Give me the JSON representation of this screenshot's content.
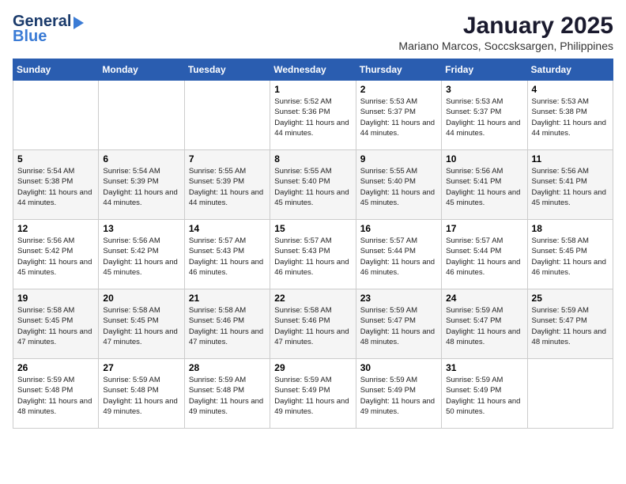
{
  "logo": {
    "line1": "General",
    "line2": "Blue"
  },
  "title": "January 2025",
  "subtitle": "Mariano Marcos, Soccsksargen, Philippines",
  "days_header": [
    "Sunday",
    "Monday",
    "Tuesday",
    "Wednesday",
    "Thursday",
    "Friday",
    "Saturday"
  ],
  "weeks": [
    [
      {
        "day": "",
        "sunrise": "",
        "sunset": "",
        "daylight": ""
      },
      {
        "day": "",
        "sunrise": "",
        "sunset": "",
        "daylight": ""
      },
      {
        "day": "",
        "sunrise": "",
        "sunset": "",
        "daylight": ""
      },
      {
        "day": "1",
        "sunrise": "Sunrise: 5:52 AM",
        "sunset": "Sunset: 5:36 PM",
        "daylight": "Daylight: 11 hours and 44 minutes."
      },
      {
        "day": "2",
        "sunrise": "Sunrise: 5:53 AM",
        "sunset": "Sunset: 5:37 PM",
        "daylight": "Daylight: 11 hours and 44 minutes."
      },
      {
        "day": "3",
        "sunrise": "Sunrise: 5:53 AM",
        "sunset": "Sunset: 5:37 PM",
        "daylight": "Daylight: 11 hours and 44 minutes."
      },
      {
        "day": "4",
        "sunrise": "Sunrise: 5:53 AM",
        "sunset": "Sunset: 5:38 PM",
        "daylight": "Daylight: 11 hours and 44 minutes."
      }
    ],
    [
      {
        "day": "5",
        "sunrise": "Sunrise: 5:54 AM",
        "sunset": "Sunset: 5:38 PM",
        "daylight": "Daylight: 11 hours and 44 minutes."
      },
      {
        "day": "6",
        "sunrise": "Sunrise: 5:54 AM",
        "sunset": "Sunset: 5:39 PM",
        "daylight": "Daylight: 11 hours and 44 minutes."
      },
      {
        "day": "7",
        "sunrise": "Sunrise: 5:55 AM",
        "sunset": "Sunset: 5:39 PM",
        "daylight": "Daylight: 11 hours and 44 minutes."
      },
      {
        "day": "8",
        "sunrise": "Sunrise: 5:55 AM",
        "sunset": "Sunset: 5:40 PM",
        "daylight": "Daylight: 11 hours and 45 minutes."
      },
      {
        "day": "9",
        "sunrise": "Sunrise: 5:55 AM",
        "sunset": "Sunset: 5:40 PM",
        "daylight": "Daylight: 11 hours and 45 minutes."
      },
      {
        "day": "10",
        "sunrise": "Sunrise: 5:56 AM",
        "sunset": "Sunset: 5:41 PM",
        "daylight": "Daylight: 11 hours and 45 minutes."
      },
      {
        "day": "11",
        "sunrise": "Sunrise: 5:56 AM",
        "sunset": "Sunset: 5:41 PM",
        "daylight": "Daylight: 11 hours and 45 minutes."
      }
    ],
    [
      {
        "day": "12",
        "sunrise": "Sunrise: 5:56 AM",
        "sunset": "Sunset: 5:42 PM",
        "daylight": "Daylight: 11 hours and 45 minutes."
      },
      {
        "day": "13",
        "sunrise": "Sunrise: 5:56 AM",
        "sunset": "Sunset: 5:42 PM",
        "daylight": "Daylight: 11 hours and 45 minutes."
      },
      {
        "day": "14",
        "sunrise": "Sunrise: 5:57 AM",
        "sunset": "Sunset: 5:43 PM",
        "daylight": "Daylight: 11 hours and 46 minutes."
      },
      {
        "day": "15",
        "sunrise": "Sunrise: 5:57 AM",
        "sunset": "Sunset: 5:43 PM",
        "daylight": "Daylight: 11 hours and 46 minutes."
      },
      {
        "day": "16",
        "sunrise": "Sunrise: 5:57 AM",
        "sunset": "Sunset: 5:44 PM",
        "daylight": "Daylight: 11 hours and 46 minutes."
      },
      {
        "day": "17",
        "sunrise": "Sunrise: 5:57 AM",
        "sunset": "Sunset: 5:44 PM",
        "daylight": "Daylight: 11 hours and 46 minutes."
      },
      {
        "day": "18",
        "sunrise": "Sunrise: 5:58 AM",
        "sunset": "Sunset: 5:45 PM",
        "daylight": "Daylight: 11 hours and 46 minutes."
      }
    ],
    [
      {
        "day": "19",
        "sunrise": "Sunrise: 5:58 AM",
        "sunset": "Sunset: 5:45 PM",
        "daylight": "Daylight: 11 hours and 47 minutes."
      },
      {
        "day": "20",
        "sunrise": "Sunrise: 5:58 AM",
        "sunset": "Sunset: 5:45 PM",
        "daylight": "Daylight: 11 hours and 47 minutes."
      },
      {
        "day": "21",
        "sunrise": "Sunrise: 5:58 AM",
        "sunset": "Sunset: 5:46 PM",
        "daylight": "Daylight: 11 hours and 47 minutes."
      },
      {
        "day": "22",
        "sunrise": "Sunrise: 5:58 AM",
        "sunset": "Sunset: 5:46 PM",
        "daylight": "Daylight: 11 hours and 47 minutes."
      },
      {
        "day": "23",
        "sunrise": "Sunrise: 5:59 AM",
        "sunset": "Sunset: 5:47 PM",
        "daylight": "Daylight: 11 hours and 48 minutes."
      },
      {
        "day": "24",
        "sunrise": "Sunrise: 5:59 AM",
        "sunset": "Sunset: 5:47 PM",
        "daylight": "Daylight: 11 hours and 48 minutes."
      },
      {
        "day": "25",
        "sunrise": "Sunrise: 5:59 AM",
        "sunset": "Sunset: 5:47 PM",
        "daylight": "Daylight: 11 hours and 48 minutes."
      }
    ],
    [
      {
        "day": "26",
        "sunrise": "Sunrise: 5:59 AM",
        "sunset": "Sunset: 5:48 PM",
        "daylight": "Daylight: 11 hours and 48 minutes."
      },
      {
        "day": "27",
        "sunrise": "Sunrise: 5:59 AM",
        "sunset": "Sunset: 5:48 PM",
        "daylight": "Daylight: 11 hours and 49 minutes."
      },
      {
        "day": "28",
        "sunrise": "Sunrise: 5:59 AM",
        "sunset": "Sunset: 5:48 PM",
        "daylight": "Daylight: 11 hours and 49 minutes."
      },
      {
        "day": "29",
        "sunrise": "Sunrise: 5:59 AM",
        "sunset": "Sunset: 5:49 PM",
        "daylight": "Daylight: 11 hours and 49 minutes."
      },
      {
        "day": "30",
        "sunrise": "Sunrise: 5:59 AM",
        "sunset": "Sunset: 5:49 PM",
        "daylight": "Daylight: 11 hours and 49 minutes."
      },
      {
        "day": "31",
        "sunrise": "Sunrise: 5:59 AM",
        "sunset": "Sunset: 5:49 PM",
        "daylight": "Daylight: 11 hours and 50 minutes."
      },
      {
        "day": "",
        "sunrise": "",
        "sunset": "",
        "daylight": ""
      }
    ]
  ]
}
